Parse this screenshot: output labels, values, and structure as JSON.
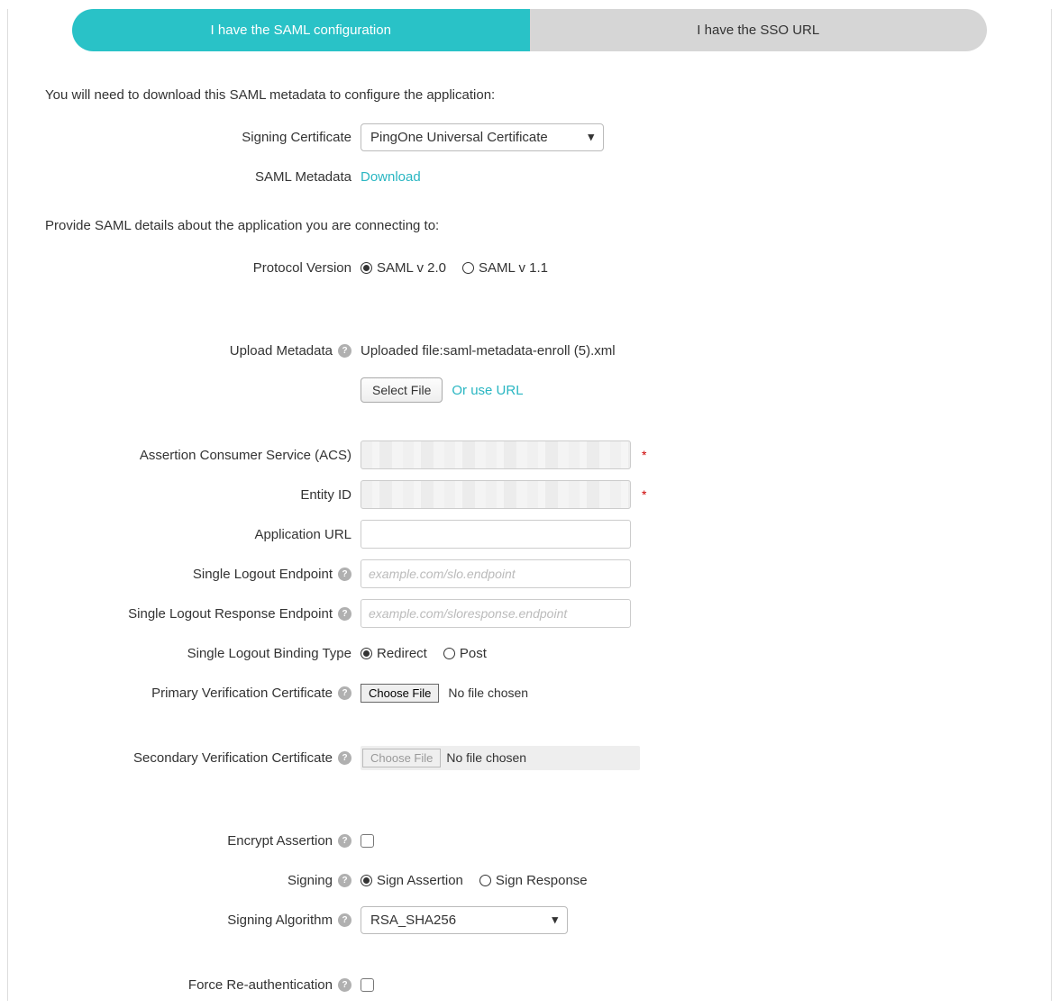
{
  "tabs": {
    "saml_config": "I have the SAML configuration",
    "sso_url": "I have the SSO URL"
  },
  "intro1": "You will need to download this SAML metadata to configure the application:",
  "intro2": "Provide SAML details about the application you are connecting to:",
  "labels": {
    "signing_cert": "Signing Certificate",
    "saml_metadata": "SAML Metadata",
    "protocol_version": "Protocol Version",
    "upload_metadata": "Upload Metadata",
    "acs": "Assertion Consumer Service (ACS)",
    "entity_id": "Entity ID",
    "app_url": "Application URL",
    "slo_endpoint": "Single Logout Endpoint",
    "slo_response_endpoint": "Single Logout Response Endpoint",
    "slo_binding_type": "Single Logout Binding Type",
    "primary_cert": "Primary Verification Certificate",
    "secondary_cert": "Secondary Verification Certificate",
    "encrypt_assertion": "Encrypt Assertion",
    "signing": "Signing",
    "signing_algorithm": "Signing Algorithm",
    "force_reauth": "Force Re-authentication"
  },
  "values": {
    "signing_cert_selected": "PingOne Universal Certificate",
    "download_link": "Download",
    "protocol_v20": "SAML v 2.0",
    "protocol_v11": "SAML v 1.1",
    "uploaded_file_text": "Uploaded file:saml-metadata-enroll (5).xml",
    "select_file_btn": "Select File",
    "or_use_url": "Or use URL",
    "slo_placeholder": "example.com/slo.endpoint",
    "slo_resp_placeholder": "example.com/sloresponse.endpoint",
    "binding_redirect": "Redirect",
    "binding_post": "Post",
    "choose_file_btn": "Choose File",
    "no_file_chosen": "No file chosen",
    "sign_assertion": "Sign Assertion",
    "sign_response": "Sign Response",
    "signing_alg_selected": "RSA_SHA256"
  }
}
